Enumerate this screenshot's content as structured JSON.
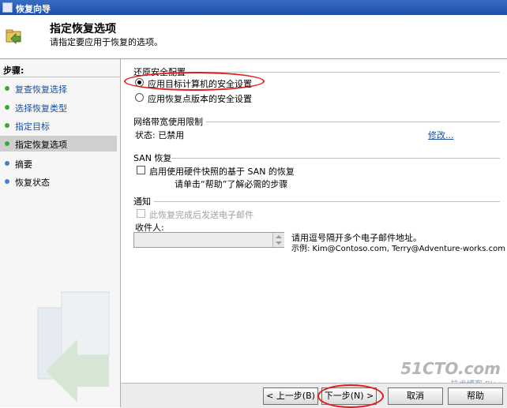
{
  "window": {
    "title": "恢复向导"
  },
  "header": {
    "title": "指定恢复选项",
    "subtitle": "请指定要应用于恢复的选项。"
  },
  "sidebar": {
    "title": "步骤:",
    "steps": [
      {
        "label": "复查恢复选择",
        "state": "done"
      },
      {
        "label": "选择恢复类型",
        "state": "done"
      },
      {
        "label": "指定目标",
        "state": "done"
      },
      {
        "label": "指定恢复选项",
        "state": "current"
      },
      {
        "label": "摘要",
        "state": "pending"
      },
      {
        "label": "恢复状态",
        "state": "pending"
      }
    ]
  },
  "security": {
    "title": "还原安全配置",
    "option_target": "应用目标计算机的安全设置",
    "option_recovery_point": "应用恢复点版本的安全设置",
    "selected": "option_target"
  },
  "bandwidth": {
    "title": "网络带宽使用限制",
    "status": "状态: 已禁用",
    "modify_link": "修改..."
  },
  "san": {
    "title": "SAN 恢复",
    "checkbox_label": "启用使用硬件快照的基于 SAN 的恢复",
    "help_text": "请单击“帮助”了解必需的步骤",
    "checked": false
  },
  "notification": {
    "title": "通知",
    "email_checkbox": "此恢复完成后发送电子邮件",
    "recipients_label": "收件人:",
    "recipients_value": "",
    "hint_line1": "请用逗号隔开多个电子邮件地址。",
    "hint_line2": "示例: Kim@Contoso.com, Terry@Adventure-works.com"
  },
  "buttons": {
    "back": "< 上一步(B)",
    "next": "下一步(N) >",
    "cancel": "取消",
    "help": "帮助"
  },
  "watermark": {
    "text": "51CTO.com",
    "subtext": "技术博客 Blog"
  },
  "colors": {
    "title_bar": "#2b5cb8",
    "link": "#1a4fa0",
    "annotation": "#e01c1c",
    "done_bullet": "#3fa535",
    "pending_bullet": "#4a7ec8"
  }
}
